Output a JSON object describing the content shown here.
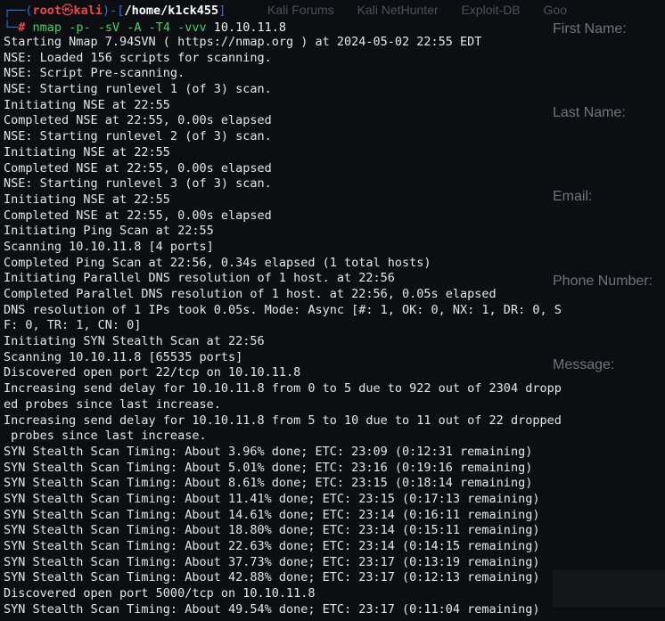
{
  "background": {
    "tabs": [
      "Kali Forums",
      "Kali NetHunter",
      "Exploit-DB",
      "Goo"
    ],
    "form_labels": [
      "First Name:",
      "Last Name:",
      "Email:",
      "Phone Number:",
      "Message:"
    ]
  },
  "prompt": {
    "user": "root",
    "separator": "㉿",
    "host": "kali",
    "cwd": "/home/k1ck455",
    "symbol": "#",
    "command": "nmap",
    "args": "-p- -sV -A -T4 -vvv",
    "target": "10.10.11.8"
  },
  "colors": {
    "background": "#0d0e11",
    "text": "#e6e6e6",
    "prompt_frame": "#3a6fd8",
    "prompt_user": "#e84a4a",
    "command": "#3fd16b"
  },
  "output_lines": [
    "Starting Nmap 7.94SVN ( https://nmap.org ) at 2024-05-02 22:55 EDT",
    "NSE: Loaded 156 scripts for scanning.",
    "NSE: Script Pre-scanning.",
    "NSE: Starting runlevel 1 (of 3) scan.",
    "Initiating NSE at 22:55",
    "Completed NSE at 22:55, 0.00s elapsed",
    "NSE: Starting runlevel 2 (of 3) scan.",
    "Initiating NSE at 22:55",
    "Completed NSE at 22:55, 0.00s elapsed",
    "NSE: Starting runlevel 3 (of 3) scan.",
    "Initiating NSE at 22:55",
    "Completed NSE at 22:55, 0.00s elapsed",
    "Initiating Ping Scan at 22:55",
    "Scanning 10.10.11.8 [4 ports]",
    "Completed Ping Scan at 22:56, 0.34s elapsed (1 total hosts)",
    "Initiating Parallel DNS resolution of 1 host. at 22:56",
    "Completed Parallel DNS resolution of 1 host. at 22:56, 0.05s elapsed",
    "DNS resolution of 1 IPs took 0.05s. Mode: Async [#: 1, OK: 0, NX: 1, DR: 0, S",
    "F: 0, TR: 1, CN: 0]",
    "Initiating SYN Stealth Scan at 22:56",
    "Scanning 10.10.11.8 [65535 ports]",
    "Discovered open port 22/tcp on 10.10.11.8",
    "Increasing send delay for 10.10.11.8 from 0 to 5 due to 922 out of 2304 dropp",
    "ed probes since last increase.",
    "Increasing send delay for 10.10.11.8 from 5 to 10 due to 11 out of 22 dropped",
    " probes since last increase.",
    "SYN Stealth Scan Timing: About 3.96% done; ETC: 23:09 (0:12:31 remaining)",
    "SYN Stealth Scan Timing: About 5.01% done; ETC: 23:16 (0:19:16 remaining)",
    "SYN Stealth Scan Timing: About 8.61% done; ETC: 23:15 (0:18:14 remaining)",
    "SYN Stealth Scan Timing: About 11.41% done; ETC: 23:15 (0:17:13 remaining)",
    "SYN Stealth Scan Timing: About 14.61% done; ETC: 23:14 (0:16:11 remaining)",
    "SYN Stealth Scan Timing: About 18.80% done; ETC: 23:14 (0:15:11 remaining)",
    "SYN Stealth Scan Timing: About 22.63% done; ETC: 23:14 (0:14:15 remaining)",
    "SYN Stealth Scan Timing: About 37.73% done; ETC: 23:17 (0:13:19 remaining)",
    "SYN Stealth Scan Timing: About 42.88% done; ETC: 23:17 (0:12:13 remaining)",
    "Discovered open port 5000/tcp on 10.10.11.8",
    "SYN Stealth Scan Timing: About 49.54% done; ETC: 23:17 (0:11:04 remaining)"
  ]
}
